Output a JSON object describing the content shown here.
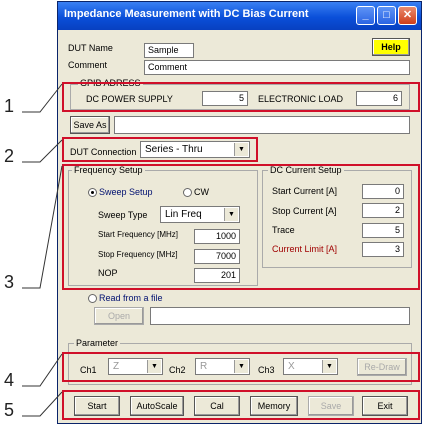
{
  "window": {
    "title": "Impedance Measurement with DC Bias Current"
  },
  "header": {
    "dut_name_label": "DUT Name",
    "dut_name_value": "Sample",
    "comment_label": "Comment",
    "comment_value": "Comment",
    "help_label": "Help"
  },
  "gpib": {
    "title": "GPIB ADRESS",
    "dc_power_label": "DC POWER SUPPLY",
    "dc_power_value": "5",
    "load_label": "ELECTRONIC LOAD",
    "load_value": "6"
  },
  "save": {
    "label": "Save As"
  },
  "dut_connection": {
    "label": "DUT Connection",
    "value": "Series - Thru"
  },
  "freq_setup": {
    "title": "Frequency Setup",
    "sweep_label": "Sweep Setup",
    "cw_label": "CW",
    "sweep_type_label": "Sweep Type",
    "sweep_type_value": "Lin Freq",
    "start_label": "Start Frequency [MHz]",
    "start_value": "1000",
    "stop_label": "Stop Frequency [MHz]",
    "stop_value": "7000",
    "nop_label": "NOP",
    "nop_value": "201"
  },
  "dc_setup": {
    "title": "DC Current Setup",
    "start_label": "Start Current [A]",
    "start_value": "0",
    "stop_label": "Stop Current [A]",
    "stop_value": "2",
    "trace_label": "Trace",
    "trace_value": "5",
    "limit_label": "Current Limit [A]",
    "limit_value": "3"
  },
  "file": {
    "read_label": "Read from a file",
    "open_label": "Open"
  },
  "parameter": {
    "title": "Parameter",
    "ch1_label": "Ch1",
    "ch1_value": "Z",
    "ch2_label": "Ch2",
    "ch2_value": "R",
    "ch3_label": "Ch3",
    "ch3_value": "X",
    "redraw_label": "Re-Draw"
  },
  "toolbar": {
    "start": "Start",
    "autoscale": "AutoScale",
    "cal": "Cal",
    "memory": "Memory",
    "save": "Save",
    "exit": "Exit"
  },
  "callouts": {
    "c1": "1",
    "c2": "2",
    "c3": "3",
    "c4": "4",
    "c5": "5"
  }
}
